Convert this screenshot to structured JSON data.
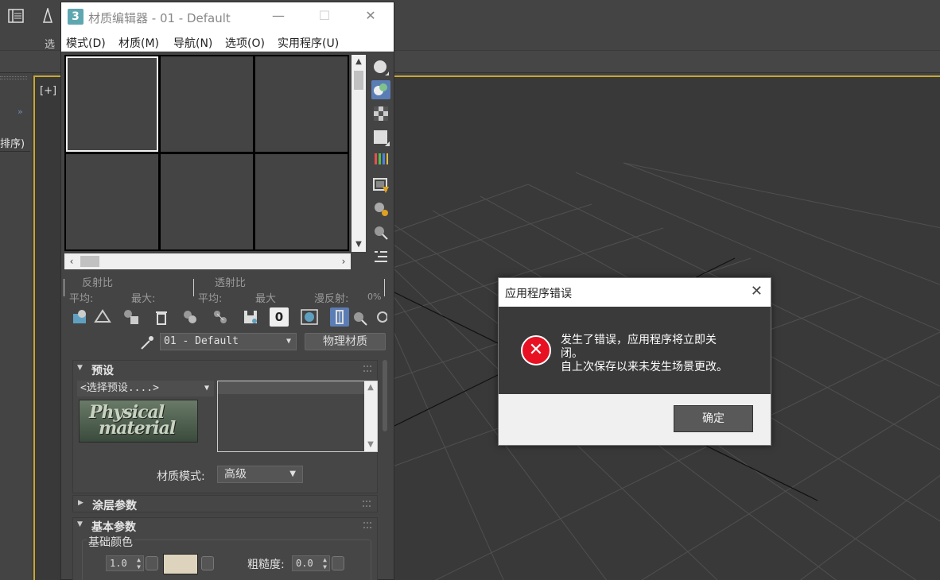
{
  "background_app": {
    "left_menu_partial": "选",
    "left_panel_sort": "排序)",
    "viewport_label": "[+]",
    "accent_color": "#c8a832"
  },
  "material_editor": {
    "title": "材质编辑器 - 01 - Default",
    "window_buttons": {
      "minimize": "—",
      "maximize": "☐",
      "close": "✕"
    },
    "menu": [
      "模式(D)",
      "材质(M)",
      "导航(N)",
      "选项(O)",
      "实用程序(U)"
    ],
    "stats": {
      "reflect_label": "反射比",
      "transmit_label": "透射比",
      "avg_label_1": "平均:",
      "max_label_1": "最大:",
      "avg_label_2": "平均:",
      "max_label_2": "最大",
      "diffuse_label": "漫反射:",
      "diffuse_value": "0%"
    },
    "slot_count_badge": "0",
    "material_name": "01 - Default",
    "material_type_button": "物理材质",
    "preset_rollout": {
      "title": "预设",
      "select_placeholder": "<选择预设....>",
      "logo_text_1": "Physical",
      "logo_text_2": "material",
      "mode_label": "材质模式:",
      "mode_value": "高级"
    },
    "coating_rollout": {
      "title": "涂层参数"
    },
    "basic_rollout": {
      "title": "基本参数",
      "group_label": "基础颜色",
      "weight_value": "1.0",
      "roughness_label": "粗糙度:",
      "roughness_value": "0.0",
      "base_color": "#ded3bd"
    }
  },
  "error_dialog": {
    "title": "应用程序错误",
    "close": "✕",
    "message_line1": "发生了错误，应用程序将立即关",
    "message_line2": "闭。",
    "message_line3": "自上次保存以来未发生场景更改。",
    "ok_button": "确定",
    "icon_glyph": "✕"
  }
}
